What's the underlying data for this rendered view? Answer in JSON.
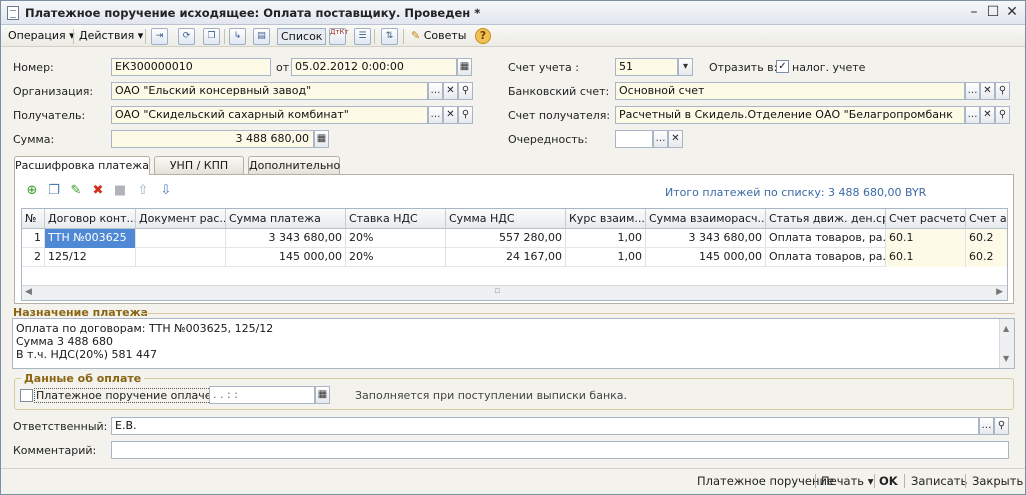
{
  "window": {
    "title": "Платежное поручение исходящее: Оплата поставщику. Проведен *"
  },
  "toolbar": {
    "operation": "Операция",
    "actions": "Действия",
    "list": "Список",
    "tips": "Советы",
    "dtkt_icon_text": "ДтКт"
  },
  "form": {
    "number_label": "Номер:",
    "number": "ЕК300000010",
    "date_label": "от",
    "date": "05.02.2012  0:00:00",
    "org_label": "Организация:",
    "org": "ОАО \"Ельский консервный завод\"",
    "recipient_label": "Получатель:",
    "recipient": "ОАО \"Скидельский сахарный комбинат\"",
    "sum_label": "Сумма:",
    "sum": "3 488 680,00",
    "account_label": "Счет учета :",
    "account": "51",
    "reflect_label": "Отразить в:",
    "tax_label": "налог. учете",
    "bank_label": "Банковский счет:",
    "bank": "Основной счет",
    "recipient_account_label": "Счет получателя:",
    "recipient_account": "Расчетный в Скидель.Отделение ОАО \"Белагропромбанк",
    "priority_label": "Очередность:"
  },
  "tabs": [
    "Расшифровка платежа",
    "УНП / КПП",
    "Дополнительно"
  ],
  "payments": {
    "total": "Итого платежей по списку: 3 488 680,00 BYR",
    "columns": [
      "№",
      "Договор конт...",
      "Документ рас...",
      "Сумма платежа",
      "Ставка НДС",
      "Сумма НДС",
      "Курс взаим...",
      "Сумма взаиморасч...",
      "Статья движ. ден.ср...",
      "Счет расчетов",
      "Счет ав"
    ],
    "rows": [
      [
        "1",
        "ТТН №003625",
        "",
        "3 343 680,00",
        "20%",
        "557 280,00",
        "1,00",
        "3 343 680,00",
        "Оплата товаров, ра...",
        "60.1",
        "60.2"
      ],
      [
        "2",
        "125/12",
        "",
        "145 000,00",
        "20%",
        "24 167,00",
        "1,00",
        "145 000,00",
        "Оплата товаров, ра...",
        "60.1",
        "60.2"
      ]
    ]
  },
  "purpose": {
    "title": "Назначение платежа",
    "lines": [
      "Оплата по договорам: ТТН №003625, 125/12",
      "Сумма 3 488 680",
      "В т.ч. НДС(20%) 581 447"
    ]
  },
  "paydata": {
    "title": "Данные об оплате",
    "checkbox": "Платежное поручение оплачено",
    "date_mask": ".  .      :  :",
    "note": "Заполняется при поступлении выписки банка."
  },
  "responsible_label": "Ответственный:",
  "responsible": "Е.В.",
  "comment_label": "Комментарий:",
  "comment": "",
  "footer": {
    "pp": "Платежное поручение",
    "print": "Печать",
    "ok": "OK",
    "save": "Записать",
    "close": "Закрыть"
  }
}
